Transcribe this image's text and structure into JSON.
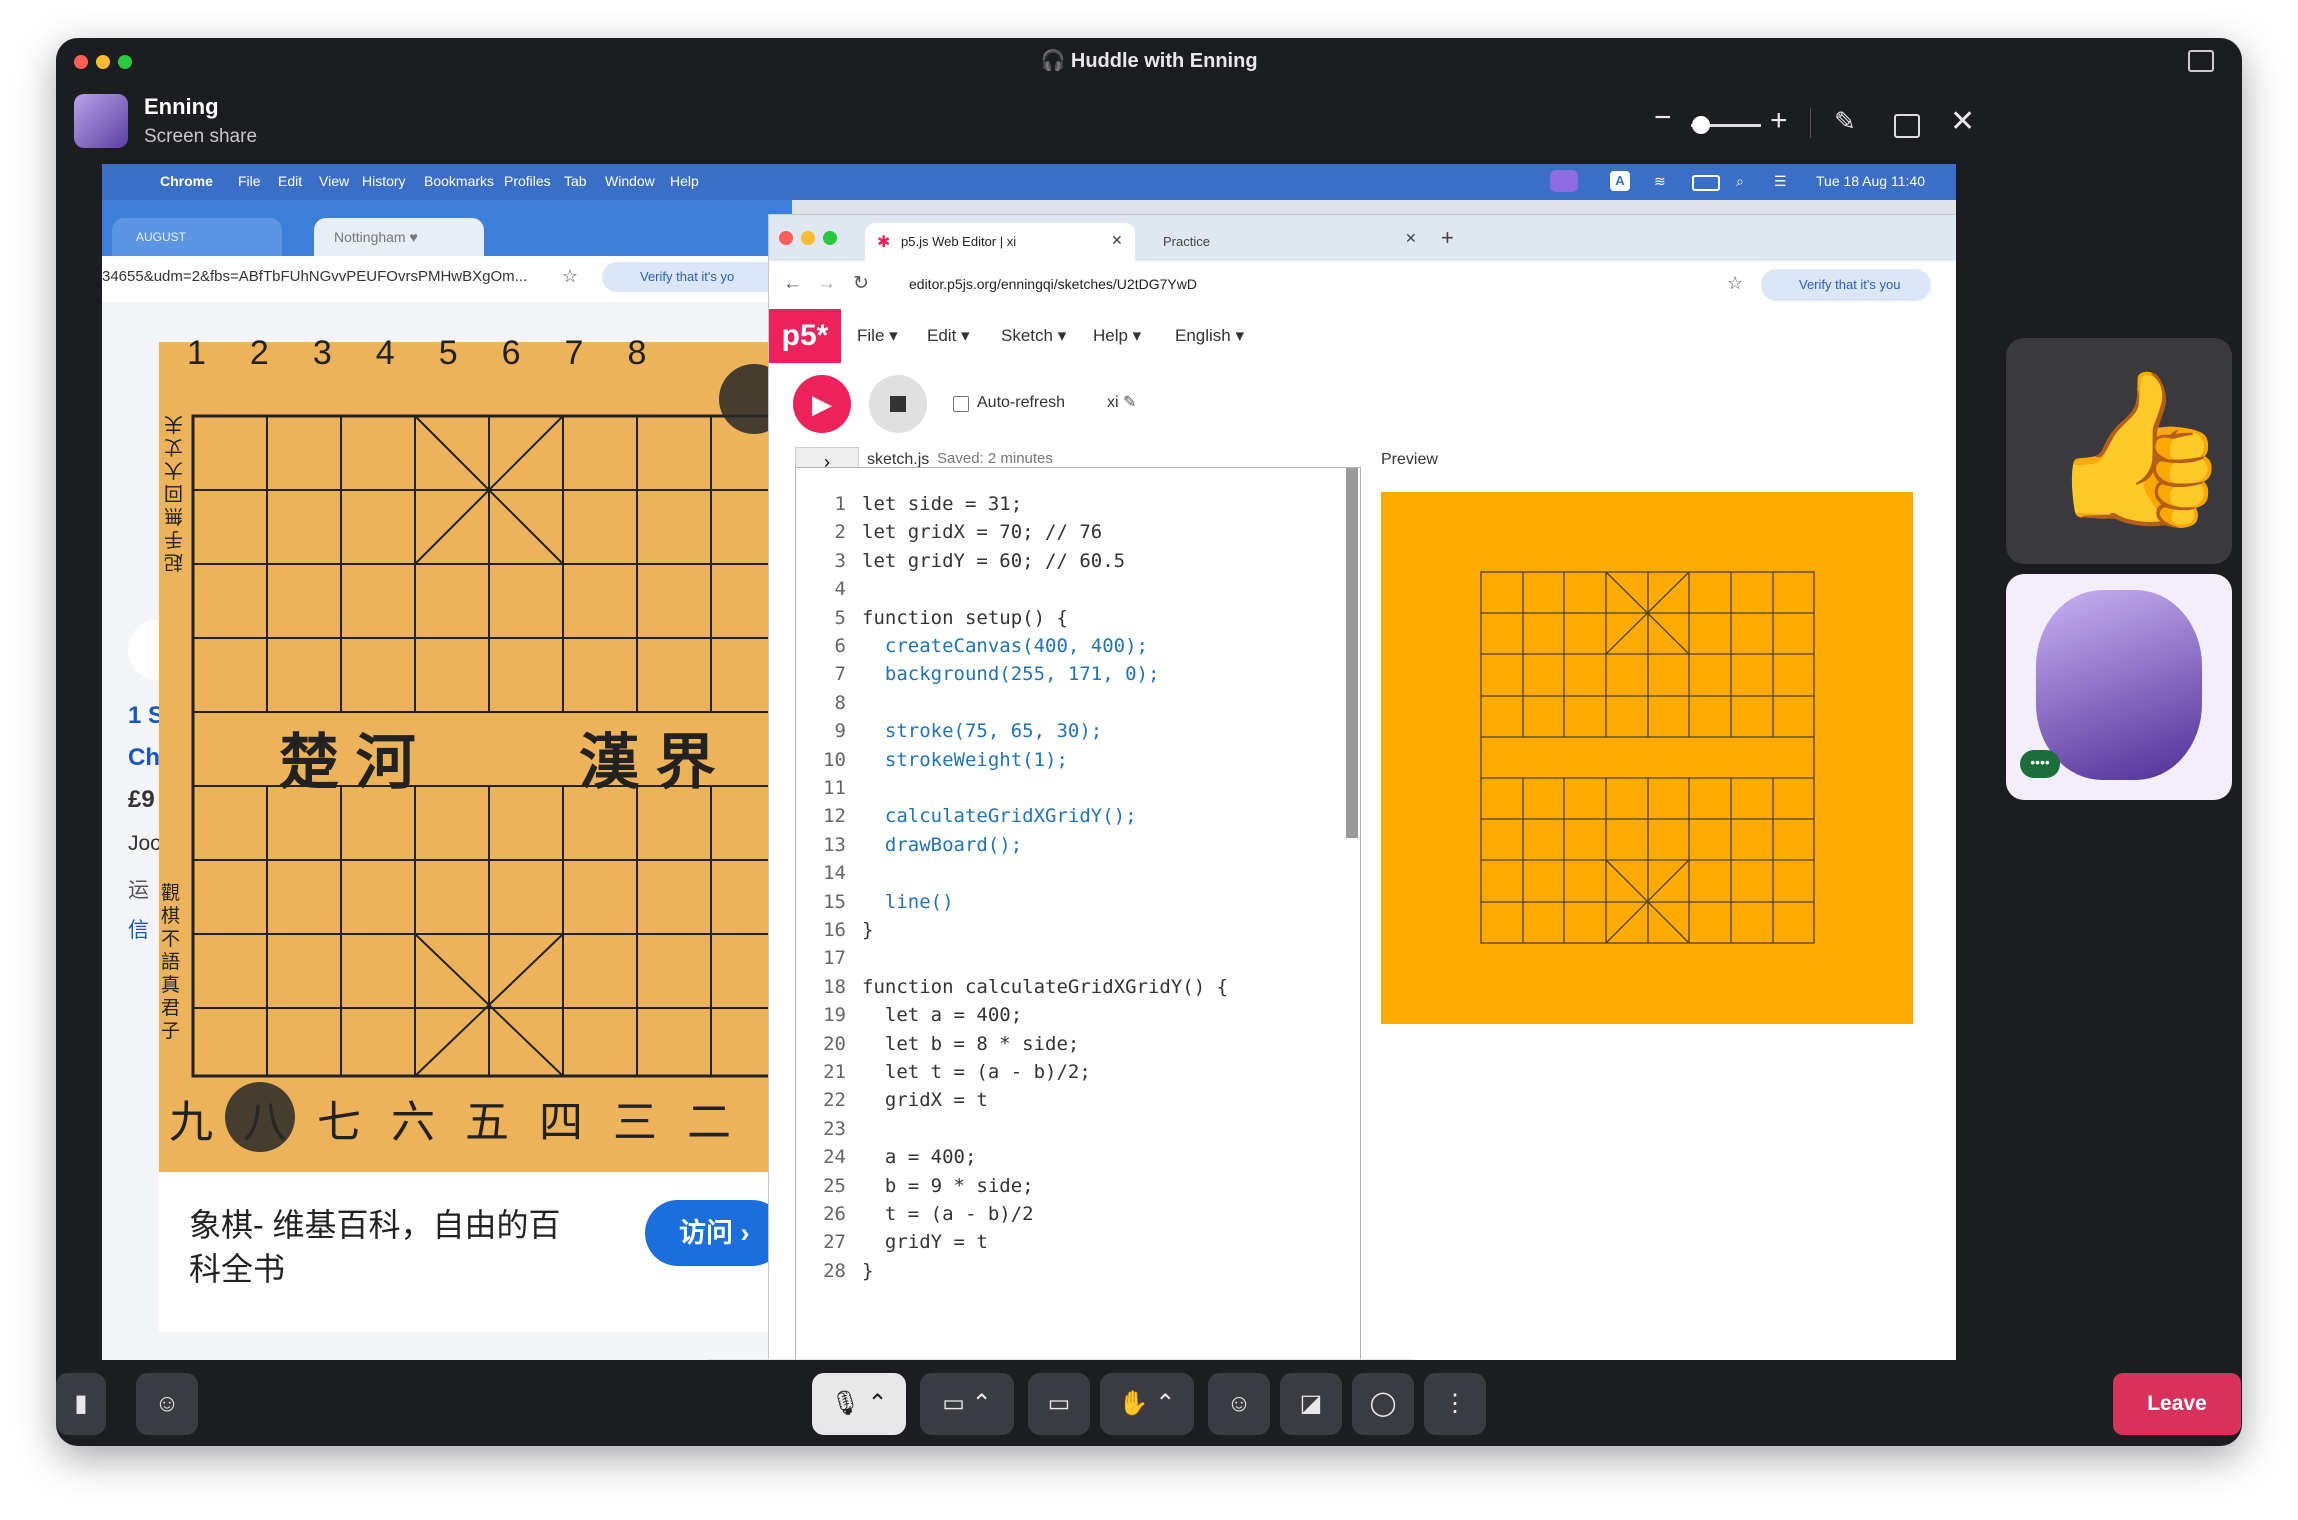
{
  "window": {
    "title": "🎧 Huddle with Enning"
  },
  "presenter": {
    "name": "Enning",
    "subtitle": "Screen share"
  },
  "mac_menubar": {
    "app": "Chrome",
    "items": [
      "File",
      "Edit",
      "View",
      "History",
      "Bookmarks",
      "Profiles",
      "Tab",
      "Window",
      "Help"
    ],
    "clock": "Tue 18 Aug  11:40",
    "input_badge": "A"
  },
  "left_browser": {
    "tab_labels": [
      "AUGUST",
      "Nottingham ♥"
    ],
    "url": "34655&udm=2&fbs=ABfTbFUhNGvvPEUFOvrsPMHwBXgOm...",
    "verify": "Verify that it's yo",
    "board_top_numbers": [
      "1",
      "2",
      "3",
      "4",
      "5",
      "6",
      "7",
      "8"
    ],
    "river_left": "楚 河",
    "river_right": "漢 界",
    "side_text_right": "觀棋不語真君子",
    "side_text_left": "起手無回大丈夫",
    "bottom_numerals": [
      "九",
      "八",
      "七",
      "六",
      "五",
      "四",
      "三",
      "二"
    ],
    "card_title_line1": "象棋- 维基百科，自由的百",
    "card_title_line2": "科全书",
    "visit_button": "访问 ›",
    "partial_left": [
      "1 S",
      "Ch",
      "£9",
      "Joo",
      "运",
      "信"
    ]
  },
  "p5_browser": {
    "tabs": [
      {
        "label": "p5.js Web Editor | xi",
        "active": true
      },
      {
        "label": "Practice",
        "active": false
      }
    ],
    "url": "editor.p5js.org/enningqi/sketches/U2tDG7YwD",
    "verify": "Verify that it's you",
    "logo": "p5*",
    "menu": [
      "File ▾",
      "Edit ▾",
      "Sketch ▾",
      "Help ▾",
      "English ▾"
    ],
    "auto_refresh": "Auto-refresh",
    "sketch_name": "xi",
    "file_name": "sketch.js",
    "saved": "Saved: 2 minutes ago",
    "preview_label": "Preview",
    "code": [
      {
        "n": "1",
        "t": "let side = 31;"
      },
      {
        "n": "2",
        "t": "let gridX = 70; // 76"
      },
      {
        "n": "3",
        "t": "let gridY = 60; // 60.5"
      },
      {
        "n": "4",
        "t": ""
      },
      {
        "n": "5",
        "t": "function setup() {"
      },
      {
        "n": "6",
        "t": "  createCanvas(400, 400);"
      },
      {
        "n": "7",
        "t": "  background(255, 171, 0);"
      },
      {
        "n": "8",
        "t": ""
      },
      {
        "n": "9",
        "t": "  stroke(75, 65, 30);"
      },
      {
        "n": "10",
        "t": "  strokeWeight(1);"
      },
      {
        "n": "11",
        "t": ""
      },
      {
        "n": "12",
        "t": "  calculateGridXGridY();"
      },
      {
        "n": "13",
        "t": "  drawBoard();"
      },
      {
        "n": "14",
        "t": ""
      },
      {
        "n": "15",
        "t": "  line()"
      },
      {
        "n": "16",
        "t": "}"
      },
      {
        "n": "17",
        "t": ""
      },
      {
        "n": "18",
        "t": "function calculateGridXGridY() {"
      },
      {
        "n": "19",
        "t": "  let a = 400;"
      },
      {
        "n": "20",
        "t": "  let b = 8 * side;"
      },
      {
        "n": "21",
        "t": "  let t = (a - b)/2;"
      },
      {
        "n": "22",
        "t": "  gridX = t"
      },
      {
        "n": "23",
        "t": ""
      },
      {
        "n": "24",
        "t": "  a = 400;"
      },
      {
        "n": "25",
        "t": "  b = 9 * side;"
      },
      {
        "n": "26",
        "t": "  t = (a - b)/2"
      },
      {
        "n": "27",
        "t": "  gridY = t"
      },
      {
        "n": "28",
        "t": "}"
      }
    ]
  },
  "controls": {
    "leave": "Leave"
  },
  "colors": {
    "leave": "#d8315b",
    "p5": "#ed225d",
    "preview_bg": "#ffab02",
    "board": "#edb35b"
  }
}
